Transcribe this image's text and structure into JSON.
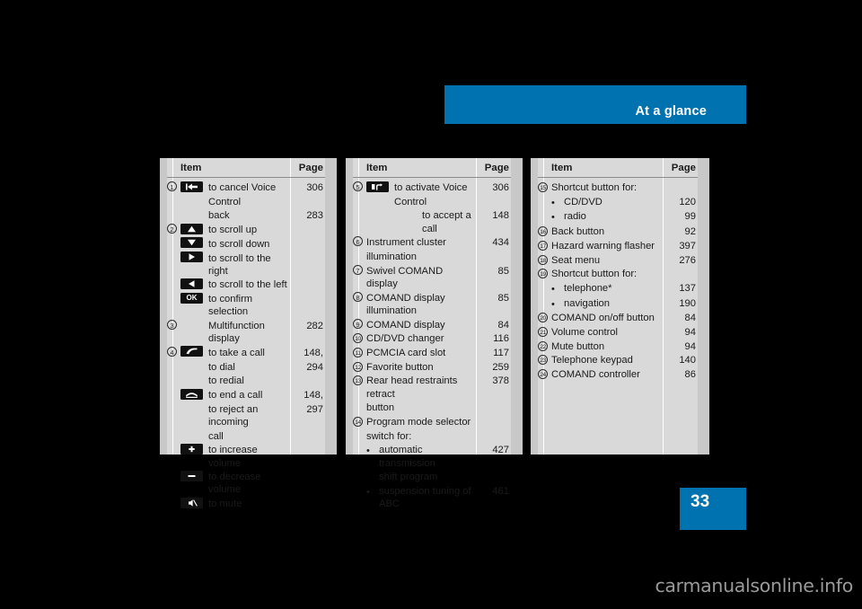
{
  "header": {
    "title": "At a glance"
  },
  "footer": {
    "page_number": "33",
    "watermark": "carmanualsonline.info"
  },
  "colors": {
    "accent_blue": "#0072B0",
    "table_bg": "#d9d9d9",
    "rail": "#c8c8c8"
  },
  "tables": [
    {
      "id": "table-1",
      "header": {
        "item": "Item",
        "page": "Page"
      },
      "rows": [
        {
          "num": "1",
          "icon": "back-arrow-icon",
          "label": "to cancel Voice",
          "page": "306"
        },
        {
          "num": "",
          "icon": "",
          "label": "Control",
          "page": ""
        },
        {
          "num": "",
          "icon": "",
          "label": "back",
          "page": "283"
        },
        {
          "num": "2",
          "icon": "triangle-up-icon",
          "label": "to scroll up",
          "page": ""
        },
        {
          "num": "",
          "icon": "triangle-down-icon",
          "label": "to scroll down",
          "page": ""
        },
        {
          "num": "",
          "icon": "triangle-right-icon",
          "label": "to scroll to the right",
          "page": ""
        },
        {
          "num": "",
          "icon": "triangle-left-icon",
          "label": "to scroll to the left",
          "page": ""
        },
        {
          "num": "",
          "icon": "ok-icon",
          "label": "to confirm selection",
          "page": ""
        },
        {
          "num": "3",
          "icon": "",
          "label": "Multifunction display",
          "page": "282"
        },
        {
          "num": "4",
          "icon": "phone-pickup-icon",
          "label": "to take a call",
          "page": "148,"
        },
        {
          "num": "",
          "icon": "",
          "label": "to dial",
          "page": "294"
        },
        {
          "num": "",
          "icon": "",
          "label": "to redial",
          "page": ""
        },
        {
          "num": "",
          "icon": "phone-hangup-icon",
          "label": "to end a call",
          "page": "148,"
        },
        {
          "num": "",
          "icon": "",
          "label": "to reject an incoming",
          "page": "297"
        },
        {
          "num": "",
          "icon": "",
          "label": "call",
          "page": ""
        },
        {
          "num": "",
          "icon": "plus-icon",
          "label": "to increase volume",
          "page": ""
        },
        {
          "num": "",
          "icon": "minus-icon",
          "label": "to decrease volume",
          "page": ""
        },
        {
          "num": "",
          "icon": "mute-icon",
          "label": "to mute",
          "page": ""
        }
      ]
    },
    {
      "id": "table-2",
      "header": {
        "item": "Item",
        "page": "Page"
      },
      "rows": [
        {
          "num": "5",
          "icon": "voice-control-icon",
          "label": "to activate Voice",
          "page": "306"
        },
        {
          "num": "",
          "icon": "",
          "label": "Control",
          "page": ""
        },
        {
          "num": "",
          "icon": "",
          "label": "to accept a call",
          "page": "148",
          "indent": true
        },
        {
          "num": "6",
          "icon": "",
          "label": "Instrument cluster",
          "page": "434",
          "noicon": true
        },
        {
          "num": "",
          "icon": "",
          "label": "illumination",
          "page": "",
          "noicon": true
        },
        {
          "num": "7",
          "icon": "",
          "label": "Swivel COMAND display",
          "page": "85",
          "noicon": true
        },
        {
          "num": "8",
          "icon": "",
          "label": "COMAND display illumination",
          "page": "85",
          "noicon": true
        },
        {
          "num": "9",
          "icon": "",
          "label": "COMAND display",
          "page": "84",
          "noicon": true
        },
        {
          "num": "10",
          "icon": "",
          "label": "CD/DVD changer",
          "page": "116",
          "noicon": true
        },
        {
          "num": "11",
          "icon": "",
          "label": "PCMCIA card slot",
          "page": "117",
          "noicon": true
        },
        {
          "num": "12",
          "icon": "",
          "label": "Favorite button",
          "page": "259",
          "noicon": true
        },
        {
          "num": "13",
          "icon": "",
          "label": "Rear head restraints retract",
          "page": "378",
          "noicon": true
        },
        {
          "num": "",
          "icon": "",
          "label": "button",
          "page": "",
          "noicon": true
        },
        {
          "num": "14",
          "icon": "",
          "label": "Program mode selector",
          "page": "",
          "noicon": true
        },
        {
          "num": "",
          "icon": "",
          "label": "switch for:",
          "page": "",
          "noicon": true
        },
        {
          "num": "",
          "icon": "",
          "label": "automatic transmission",
          "page": "427",
          "bullet": true
        },
        {
          "num": "",
          "icon": "",
          "label": "shift program",
          "page": "",
          "bulletcont": true
        },
        {
          "num": "",
          "icon": "",
          "label": "suspension tuning of ABC",
          "page": "461",
          "bullet": true
        }
      ]
    },
    {
      "id": "table-3",
      "header": {
        "item": "Item",
        "page": "Page"
      },
      "rows": [
        {
          "num": "15",
          "label": "Shortcut button for:",
          "page": "",
          "noicon": true
        },
        {
          "num": "",
          "label": "CD/DVD",
          "page": "120",
          "bullet": true
        },
        {
          "num": "",
          "label": "radio",
          "page": "99",
          "bullet": true
        },
        {
          "num": "16",
          "label": "Back button",
          "page": "92",
          "noicon": true
        },
        {
          "num": "17",
          "label": "Hazard warning flasher",
          "page": "397",
          "noicon": true
        },
        {
          "num": "18",
          "label": "Seat menu",
          "page": "276",
          "noicon": true
        },
        {
          "num": "19",
          "label": "Shortcut button for:",
          "page": "",
          "noicon": true
        },
        {
          "num": "",
          "label": "telephone*",
          "page": "137",
          "bullet": true
        },
        {
          "num": "",
          "label": "navigation",
          "page": "190",
          "bullet": true
        },
        {
          "num": "20",
          "label": "COMAND on/off button",
          "page": "84",
          "noicon": true
        },
        {
          "num": "21",
          "label": "Volume control",
          "page": "94",
          "noicon": true
        },
        {
          "num": "22",
          "label": "Mute button",
          "page": "94",
          "noicon": true
        },
        {
          "num": "23",
          "label": "Telephone keypad",
          "page": "140",
          "noicon": true
        },
        {
          "num": "24",
          "label": "COMAND controller",
          "page": "86",
          "noicon": true
        }
      ]
    }
  ]
}
